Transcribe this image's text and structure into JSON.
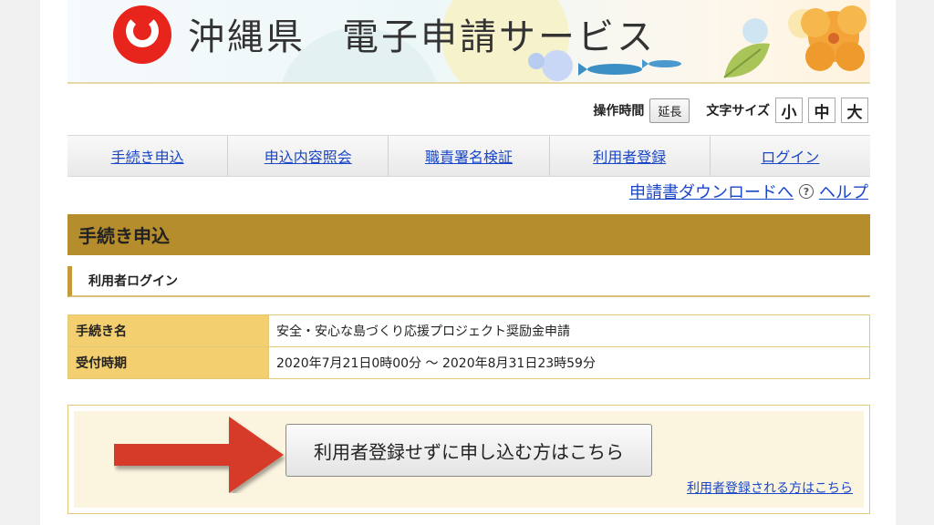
{
  "header": {
    "title_prefix": "沖縄県",
    "title_suffix": "電子申請サービス"
  },
  "toolbar": {
    "time_label": "操作時間",
    "extend_button": "延長",
    "font_size_label": "文字サイズ",
    "size_small": "小",
    "size_medium": "中",
    "size_large": "大"
  },
  "nav": {
    "items": [
      {
        "label": "手続き申込"
      },
      {
        "label": "申込内容照会"
      },
      {
        "label": "職責署名検証"
      },
      {
        "label": "利用者登録"
      },
      {
        "label": "ログイン"
      }
    ]
  },
  "sublinks": {
    "download": "申請書ダウンロードへ",
    "help": "ヘルプ"
  },
  "section": {
    "title": "手続き申込",
    "subtitle": "利用者ログイン"
  },
  "info": {
    "rows": [
      {
        "label": "手続き名",
        "value": "安全・安心な島づくり応援プロジェクト奨励金申請"
      },
      {
        "label": "受付時期",
        "value": "2020年7月21日0時00分 〜 2020年8月31日23時59分"
      }
    ]
  },
  "apply": {
    "no_registration_button": "利用者登録せずに申し込む方はこちら",
    "registered_link": "利用者登録される方はこちら"
  },
  "colors": {
    "accent": "#b58d2c",
    "label_bg": "#f4cf6f",
    "link": "#1a47c8",
    "arrow": "#d63a2a"
  }
}
